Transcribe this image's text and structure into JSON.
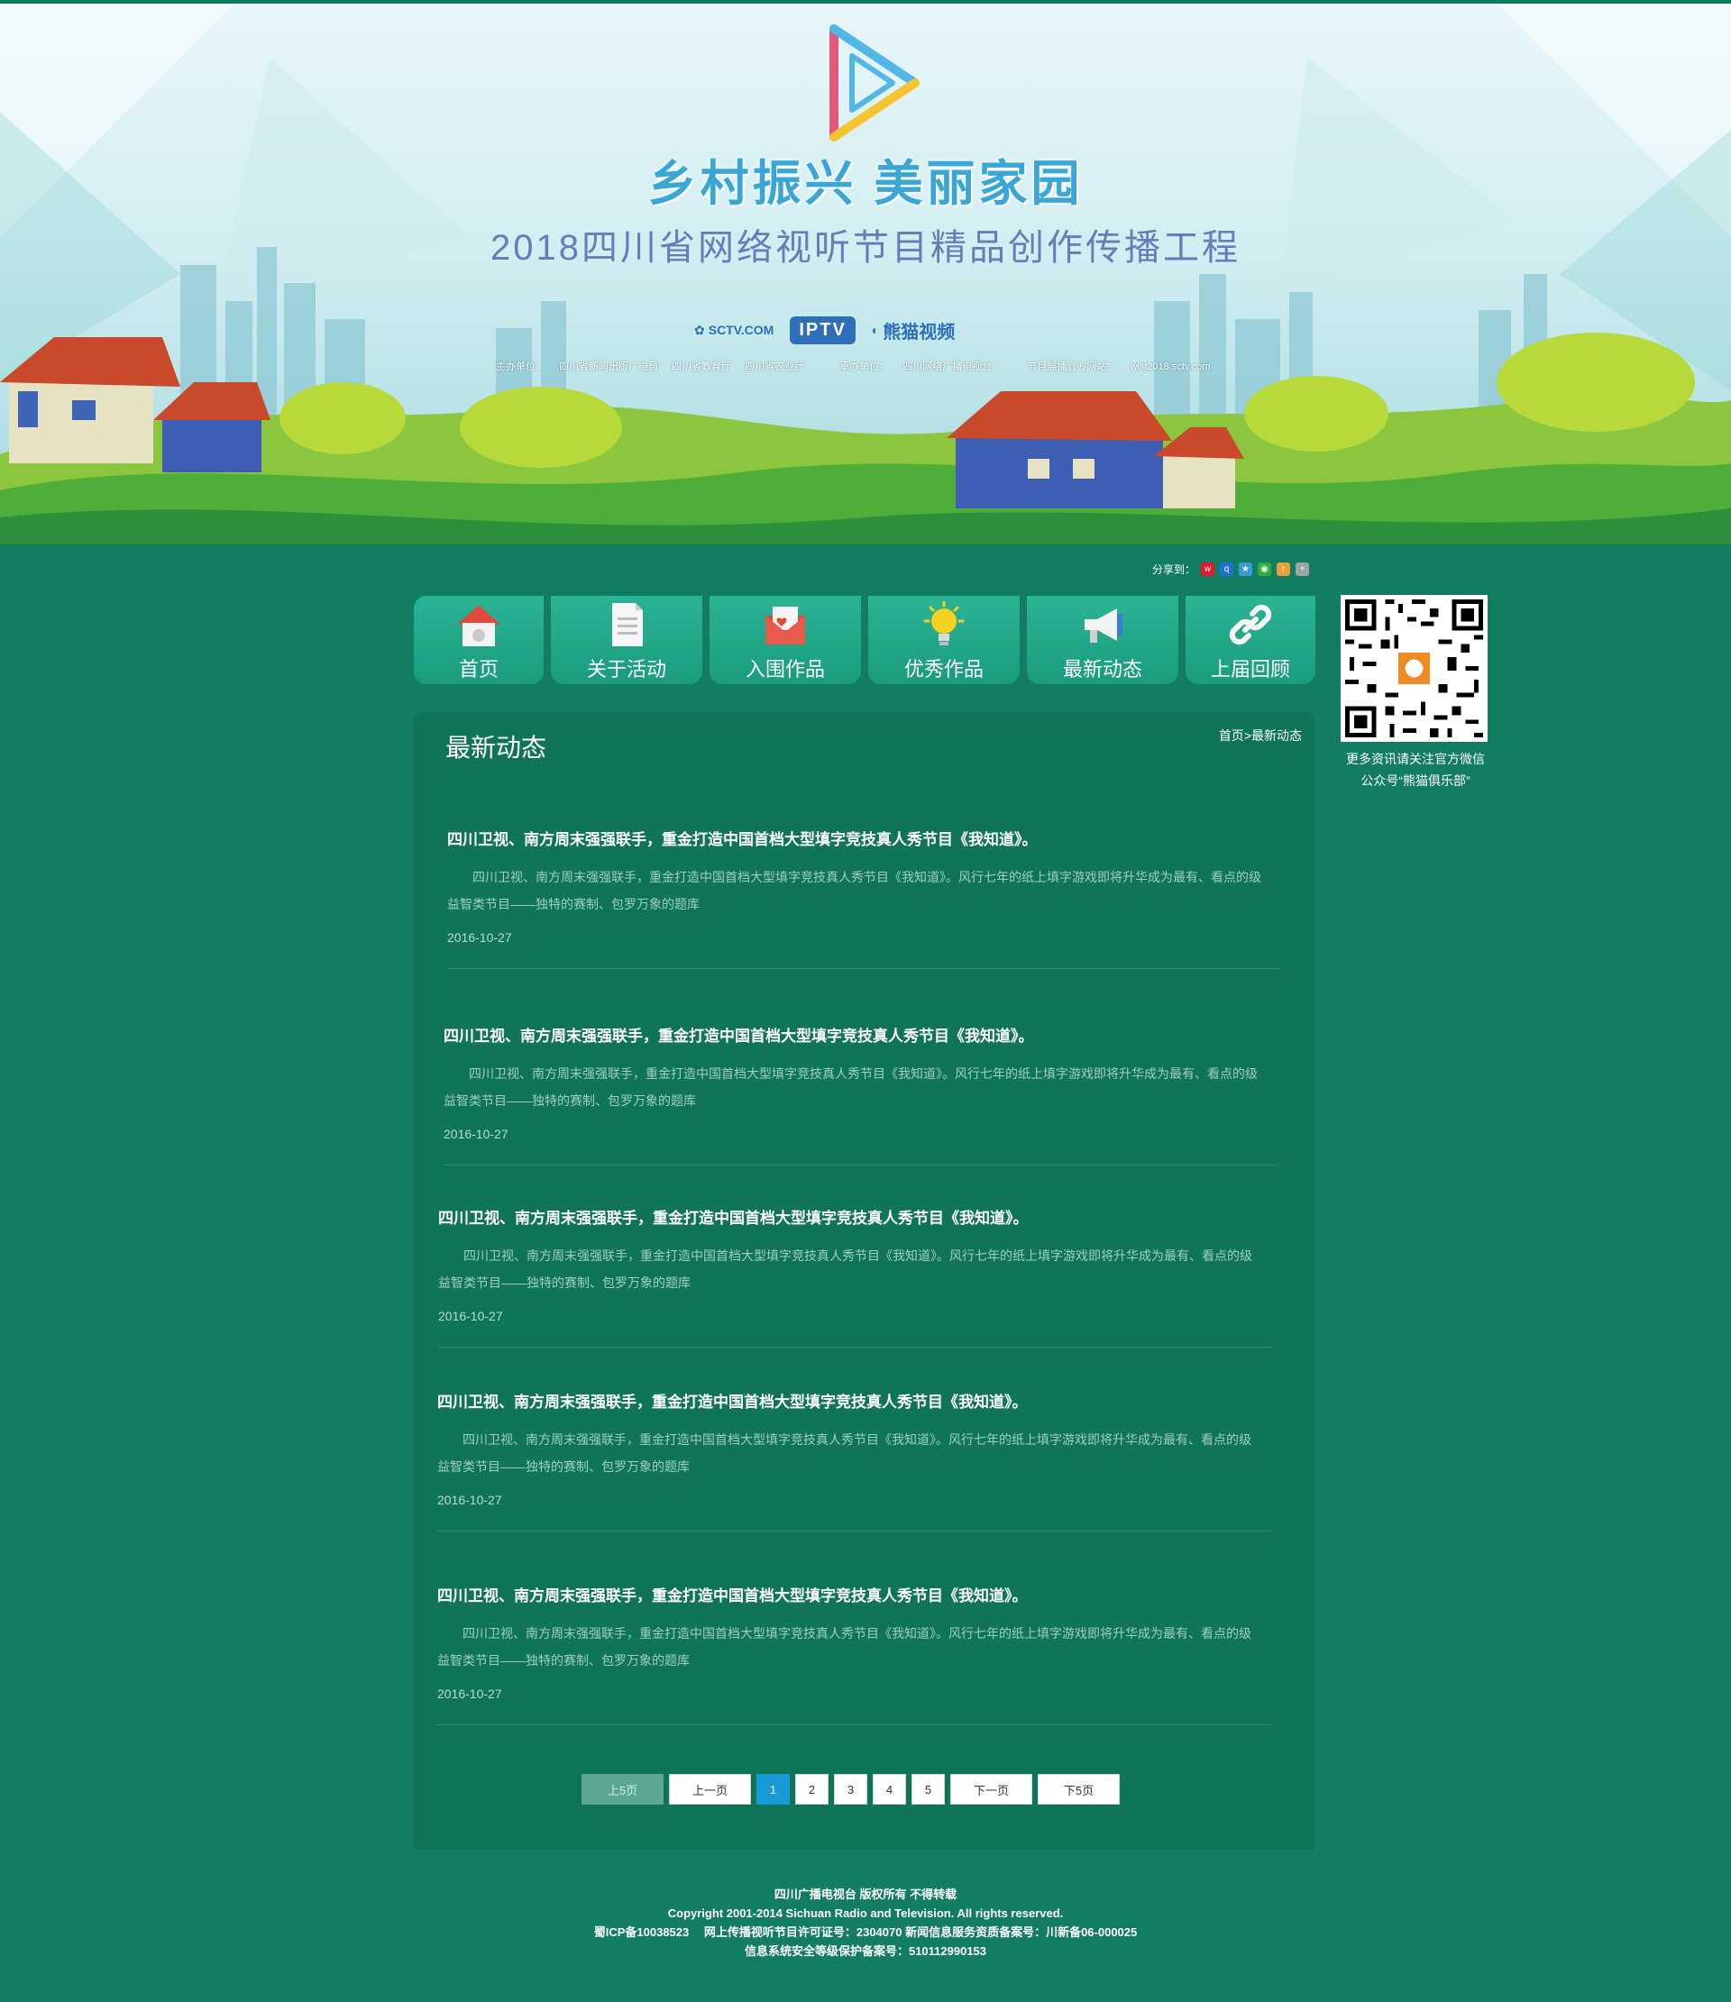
{
  "banner": {
    "slogan": "乡村振兴 美丽家园",
    "subtitle": "2018四川省网络视听节目精品创作传播工程",
    "partners": [
      "SCTV.COM",
      "IPTV",
      "熊猫视频"
    ],
    "organizers": [
      "主办单位：",
      "四川省新闻出版广电局",
      "四川省教育厅",
      "四川省农业厅",
      "承办单位：",
      "四川网络广播电视台",
      "节目展播官方网站：",
      "wlst2018.sctv.com"
    ]
  },
  "share": {
    "label": "分享到："
  },
  "nav": [
    {
      "label": "首页",
      "icon": "home-icon"
    },
    {
      "label": "关于活动",
      "icon": "document-icon"
    },
    {
      "label": "入围作品",
      "icon": "envelope-icon"
    },
    {
      "label": "优秀作品",
      "icon": "lightbulb-icon"
    },
    {
      "label": "最新动态",
      "icon": "megaphone-icon"
    },
    {
      "label": "上届回顾",
      "icon": "link-icon"
    }
  ],
  "qr": {
    "caption_line1": "更多资讯请关注官方微信",
    "caption_line2": "公众号“熊猫俱乐部”"
  },
  "panel": {
    "title": "最新动态",
    "breadcrumb": {
      "home": "首页",
      "sep": ">",
      "current": "最新动态"
    }
  },
  "news": [
    {
      "title": "四川卫视、南方周末强强联手，重金打造中国首档大型填字竞技真人秀节目《我知道》。",
      "summary": "四川卫视、南方周末强强联手，重金打造中国首档大型填字竞技真人秀节目《我知道》。风行七年的纸上填字游戏即将升华成为最有、看点的级益智类节目——独特的赛制、包罗万象的题库",
      "date": "2016-10-27"
    },
    {
      "title": "四川卫视、南方周末强强联手，重金打造中国首档大型填字竞技真人秀节目《我知道》。",
      "summary": "四川卫视、南方周末强强联手，重金打造中国首档大型填字竞技真人秀节目《我知道》。风行七年的纸上填字游戏即将升华成为最有、看点的级益智类节目——独特的赛制、包罗万象的题库",
      "date": "2016-10-27"
    },
    {
      "title": "四川卫视、南方周末强强联手，重金打造中国首档大型填字竞技真人秀节目《我知道》。",
      "summary": "四川卫视、南方周末强强联手，重金打造中国首档大型填字竞技真人秀节目《我知道》。风行七年的纸上填字游戏即将升华成为最有、看点的级益智类节目——独特的赛制、包罗万象的题库",
      "date": "2016-10-27"
    },
    {
      "title": "四川卫视、南方周末强强联手，重金打造中国首档大型填字竞技真人秀节目《我知道》。",
      "summary": "四川卫视、南方周末强强联手，重金打造中国首档大型填字竞技真人秀节目《我知道》。风行七年的纸上填字游戏即将升华成为最有、看点的级益智类节目——独特的赛制、包罗万象的题库",
      "date": "2016-10-27"
    },
    {
      "title": "四川卫视、南方周末强强联手，重金打造中国首档大型填字竞技真人秀节目《我知道》。",
      "summary": "四川卫视、南方周末强强联手，重金打造中国首档大型填字竞技真人秀节目《我知道》。风行七年的纸上填字游戏即将升华成为最有、看点的级益智类节目——独特的赛制、包罗万象的题库",
      "date": "2016-10-27"
    }
  ],
  "pager": {
    "prev5": "上5页",
    "prev": "上一页",
    "pages": [
      "1",
      "2",
      "3",
      "4",
      "5"
    ],
    "current_page": "1",
    "next": "下一页",
    "next5": "下5页"
  },
  "footer": {
    "line1": "四川广播电视台 版权所有 不得转载",
    "line2": "Copyright 2001-2014 Sichuan Radio and Television. All rights reserved.",
    "line3": "蜀ICP备10038523　 网上传播视听节目许可证号：2304070 新闻信息服务资质备案号：川新备06-000025",
    "line4": "信息系统安全等级保护备案号：510112990153"
  },
  "colors": {
    "page_bg": "#127d62",
    "panel_bg": "#0f7458",
    "nav_bg": "#1fa487",
    "active_page": "#1a9bd7"
  }
}
